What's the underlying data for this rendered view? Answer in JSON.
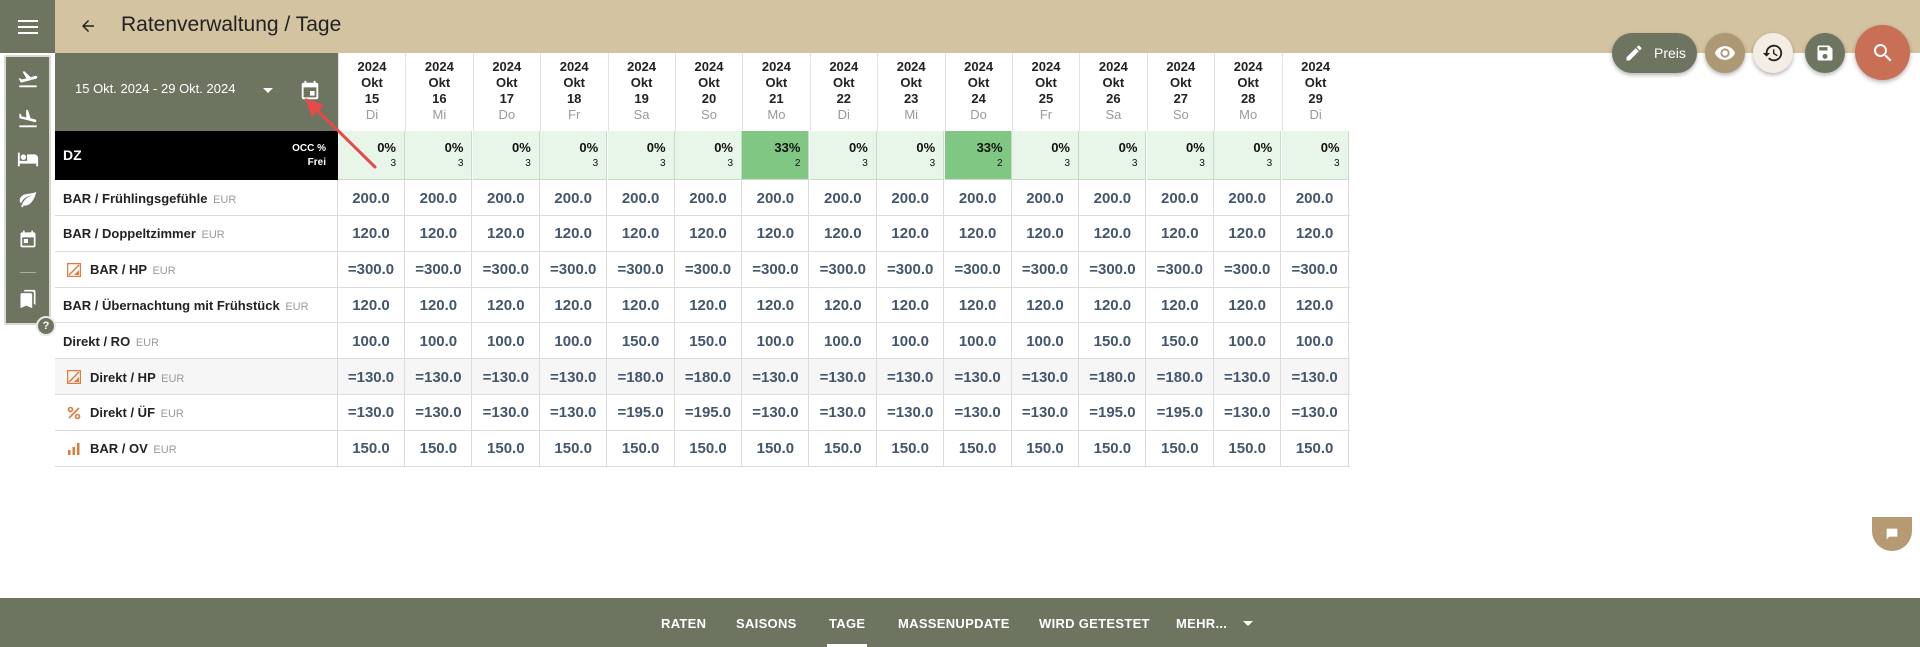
{
  "header": {
    "title": "Ratenverwaltung / Tage"
  },
  "fabs": {
    "preis_label": "Preis"
  },
  "range": {
    "label": "15 Okt. 2024 - 29 Okt. 2024"
  },
  "help": "?",
  "days": [
    {
      "year": "2024",
      "month": "Okt",
      "day": "15",
      "weekday": "Di"
    },
    {
      "year": "2024",
      "month": "Okt",
      "day": "16",
      "weekday": "Mi"
    },
    {
      "year": "2024",
      "month": "Okt",
      "day": "17",
      "weekday": "Do"
    },
    {
      "year": "2024",
      "month": "Okt",
      "day": "18",
      "weekday": "Fr"
    },
    {
      "year": "2024",
      "month": "Okt",
      "day": "19",
      "weekday": "Sa"
    },
    {
      "year": "2024",
      "month": "Okt",
      "day": "20",
      "weekday": "So"
    },
    {
      "year": "2024",
      "month": "Okt",
      "day": "21",
      "weekday": "Mo"
    },
    {
      "year": "2024",
      "month": "Okt",
      "day": "22",
      "weekday": "Di"
    },
    {
      "year": "2024",
      "month": "Okt",
      "day": "23",
      "weekday": "Mi"
    },
    {
      "year": "2024",
      "month": "Okt",
      "day": "24",
      "weekday": "Do"
    },
    {
      "year": "2024",
      "month": "Okt",
      "day": "25",
      "weekday": "Fr"
    },
    {
      "year": "2024",
      "month": "Okt",
      "day": "26",
      "weekday": "Sa"
    },
    {
      "year": "2024",
      "month": "Okt",
      "day": "27",
      "weekday": "So"
    },
    {
      "year": "2024",
      "month": "Okt",
      "day": "28",
      "weekday": "Mo"
    },
    {
      "year": "2024",
      "month": "Okt",
      "day": "29",
      "weekday": "Di"
    }
  ],
  "occupancy": {
    "room": "DZ",
    "occ_label": "OCC %",
    "free_label": "Frei",
    "values": [
      {
        "pct": "0%",
        "free": "3",
        "high": false
      },
      {
        "pct": "0%",
        "free": "3",
        "high": false
      },
      {
        "pct": "0%",
        "free": "3",
        "high": false
      },
      {
        "pct": "0%",
        "free": "3",
        "high": false
      },
      {
        "pct": "0%",
        "free": "3",
        "high": false
      },
      {
        "pct": "0%",
        "free": "3",
        "high": false
      },
      {
        "pct": "33%",
        "free": "2",
        "high": true
      },
      {
        "pct": "0%",
        "free": "3",
        "high": false
      },
      {
        "pct": "0%",
        "free": "3",
        "high": false
      },
      {
        "pct": "33%",
        "free": "2",
        "high": true
      },
      {
        "pct": "0%",
        "free": "3",
        "high": false
      },
      {
        "pct": "0%",
        "free": "3",
        "high": false
      },
      {
        "pct": "0%",
        "free": "3",
        "high": false
      },
      {
        "pct": "0%",
        "free": "3",
        "high": false
      },
      {
        "pct": "0%",
        "free": "3",
        "high": false
      }
    ]
  },
  "rates": [
    {
      "name": "BAR / Frühlingsgefühle",
      "currency": "EUR",
      "icon": "",
      "alt": false,
      "values": [
        "200.0",
        "200.0",
        "200.0",
        "200.0",
        "200.0",
        "200.0",
        "200.0",
        "200.0",
        "200.0",
        "200.0",
        "200.0",
        "200.0",
        "200.0",
        "200.0",
        "200.0"
      ]
    },
    {
      "name": "BAR / Doppeltzimmer",
      "currency": "EUR",
      "icon": "",
      "alt": false,
      "values": [
        "120.0",
        "120.0",
        "120.0",
        "120.0",
        "120.0",
        "120.0",
        "120.0",
        "120.0",
        "120.0",
        "120.0",
        "120.0",
        "120.0",
        "120.0",
        "120.0",
        "120.0"
      ]
    },
    {
      "name": "BAR / HP",
      "currency": "EUR",
      "icon": "derived-icon",
      "alt": false,
      "values": [
        "=300.0",
        "=300.0",
        "=300.0",
        "=300.0",
        "=300.0",
        "=300.0",
        "=300.0",
        "=300.0",
        "=300.0",
        "=300.0",
        "=300.0",
        "=300.0",
        "=300.0",
        "=300.0",
        "=300.0"
      ]
    },
    {
      "name": "BAR / Übernachtung mit Frühstück",
      "currency": "EUR",
      "icon": "",
      "alt": false,
      "values": [
        "120.0",
        "120.0",
        "120.0",
        "120.0",
        "120.0",
        "120.0",
        "120.0",
        "120.0",
        "120.0",
        "120.0",
        "120.0",
        "120.0",
        "120.0",
        "120.0",
        "120.0"
      ]
    },
    {
      "name": "Direkt / RO",
      "currency": "EUR",
      "icon": "",
      "alt": false,
      "values": [
        "100.0",
        "100.0",
        "100.0",
        "100.0",
        "150.0",
        "150.0",
        "100.0",
        "100.0",
        "100.0",
        "100.0",
        "100.0",
        "150.0",
        "150.0",
        "100.0",
        "100.0"
      ]
    },
    {
      "name": "Direkt / HP",
      "currency": "EUR",
      "icon": "derived-icon",
      "alt": true,
      "values": [
        "=130.0",
        "=130.0",
        "=130.0",
        "=130.0",
        "=180.0",
        "=180.0",
        "=130.0",
        "=130.0",
        "=130.0",
        "=130.0",
        "=130.0",
        "=180.0",
        "=180.0",
        "=130.0",
        "=130.0"
      ]
    },
    {
      "name": "Direkt / ÜF",
      "currency": "EUR",
      "icon": "percent-icon",
      "alt": false,
      "values": [
        "=130.0",
        "=130.0",
        "=130.0",
        "=130.0",
        "=195.0",
        "=195.0",
        "=130.0",
        "=130.0",
        "=130.0",
        "=130.0",
        "=130.0",
        "=195.0",
        "=195.0",
        "=130.0",
        "=130.0"
      ]
    },
    {
      "name": "BAR / OV",
      "currency": "EUR",
      "icon": "bar-chart-icon",
      "alt": false,
      "values": [
        "150.0",
        "150.0",
        "150.0",
        "150.0",
        "150.0",
        "150.0",
        "150.0",
        "150.0",
        "150.0",
        "150.0",
        "150.0",
        "150.0",
        "150.0",
        "150.0",
        "150.0"
      ]
    }
  ],
  "tabs": [
    {
      "label": "RATEN",
      "active": false
    },
    {
      "label": "SAISONS",
      "active": false
    },
    {
      "label": "TAGE",
      "active": true
    },
    {
      "label": "MASSENUPDATE",
      "active": false
    },
    {
      "label": "WIRD GETESTET",
      "active": false
    },
    {
      "label": "MEHR...",
      "active": false
    }
  ],
  "colors": {
    "header": "#d4c3a1",
    "olive": "#6d7460",
    "accent_orange": "#e07b39",
    "occ_high": "#81c784",
    "occ_low": "#e8f5e9",
    "search_fab": "#c96f56"
  }
}
